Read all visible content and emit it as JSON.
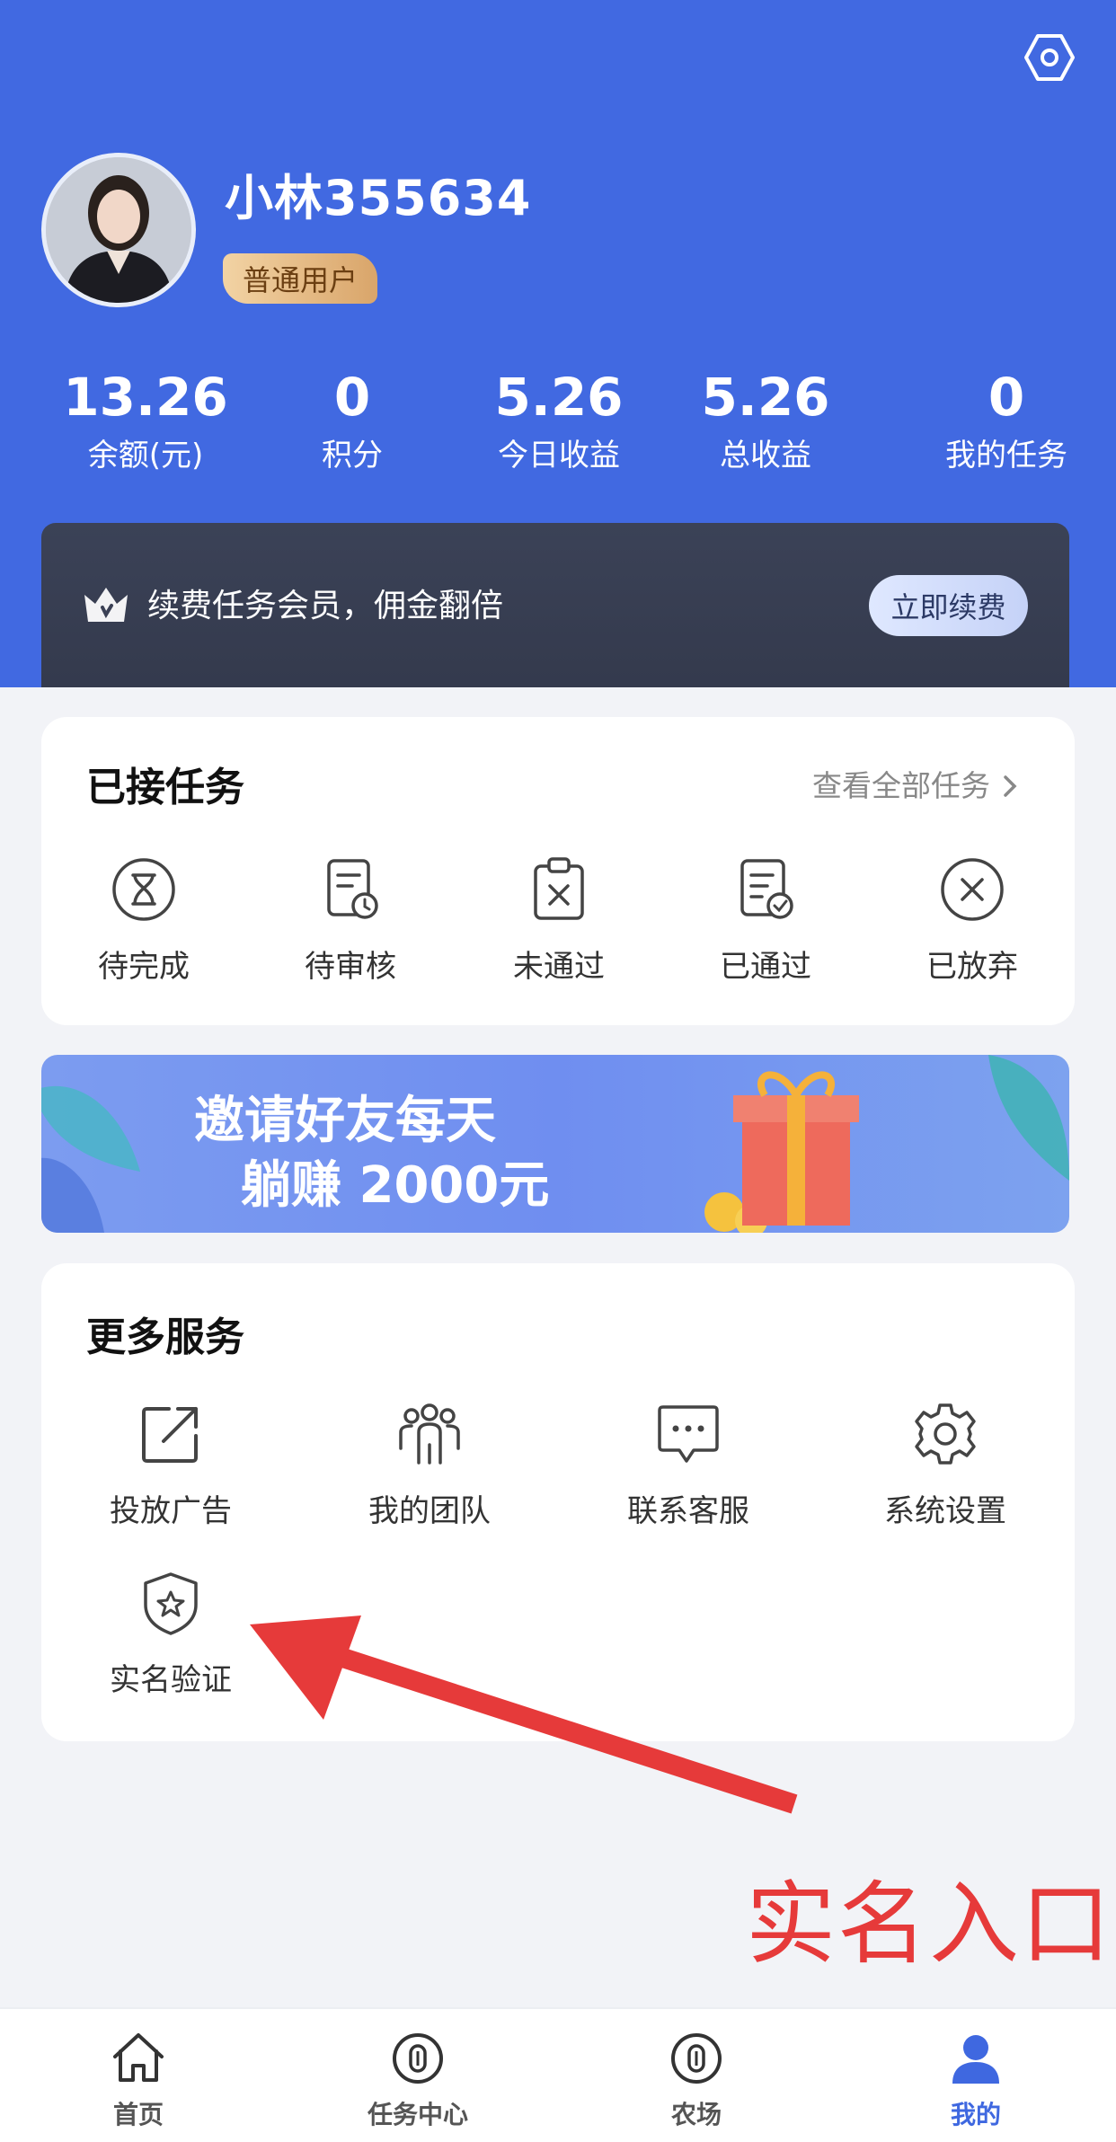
{
  "header": {
    "username": "小林355634",
    "user_level": "普通用户"
  },
  "stats": [
    {
      "value": "13.26",
      "label": "余额(元)"
    },
    {
      "value": "0",
      "label": "积分"
    },
    {
      "value": "5.26",
      "label": "今日收益"
    },
    {
      "value": "5.26",
      "label": "总收益"
    },
    {
      "value": "0",
      "label": "我的任务"
    }
  ],
  "vip": {
    "text": "续费任务会员，佣金翻倍",
    "button": "立即续费"
  },
  "accepted_tasks": {
    "title": "已接任务",
    "view_all": "查看全部任务",
    "items": [
      {
        "label": "待完成",
        "icon": "hourglass-icon"
      },
      {
        "label": "待审核",
        "icon": "document-clock-icon"
      },
      {
        "label": "未通过",
        "icon": "clipboard-x-icon"
      },
      {
        "label": "已通过",
        "icon": "document-check-icon"
      },
      {
        "label": "已放弃",
        "icon": "circle-x-icon"
      }
    ]
  },
  "promo": {
    "line1": "邀请好友每天",
    "line2": "躺赚 2000元"
  },
  "more_services": {
    "title": "更多服务",
    "items": [
      {
        "label": "投放广告",
        "icon": "external-link-icon"
      },
      {
        "label": "我的团队",
        "icon": "team-icon"
      },
      {
        "label": "联系客服",
        "icon": "chat-icon"
      },
      {
        "label": "系统设置",
        "icon": "gear-icon"
      },
      {
        "label": "实名验证",
        "icon": "shield-star-icon"
      }
    ]
  },
  "annotation": "实名入口",
  "tabbar": [
    {
      "label": "首页",
      "icon": "home-icon",
      "active": false
    },
    {
      "label": "任务中心",
      "icon": "coin-icon",
      "active": false
    },
    {
      "label": "农场",
      "icon": "coin-icon",
      "active": false
    },
    {
      "label": "我的",
      "icon": "person-icon",
      "active": true
    }
  ],
  "colors": {
    "primary": "#4169e1",
    "annotation_red": "#e63a3a",
    "vip_dark": "#353b4f"
  }
}
